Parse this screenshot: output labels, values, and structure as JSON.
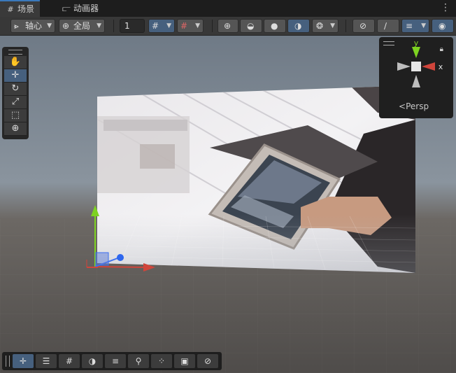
{
  "tabs": [
    {
      "label": "场景",
      "icon": "grid-icon"
    },
    {
      "label": "动画器",
      "icon": "animator-icon"
    }
  ],
  "toolbar": {
    "pivot_label": "轴心",
    "global_label": "全局",
    "snap_value": "1"
  },
  "gizmo": {
    "y_label": "y",
    "x_label": "x",
    "projection_label": "Persp"
  },
  "colors": {
    "accent": "#46607e",
    "axis_x": "#d0453b",
    "axis_y": "#7ed321",
    "axis_z": "#3c6ff0"
  }
}
